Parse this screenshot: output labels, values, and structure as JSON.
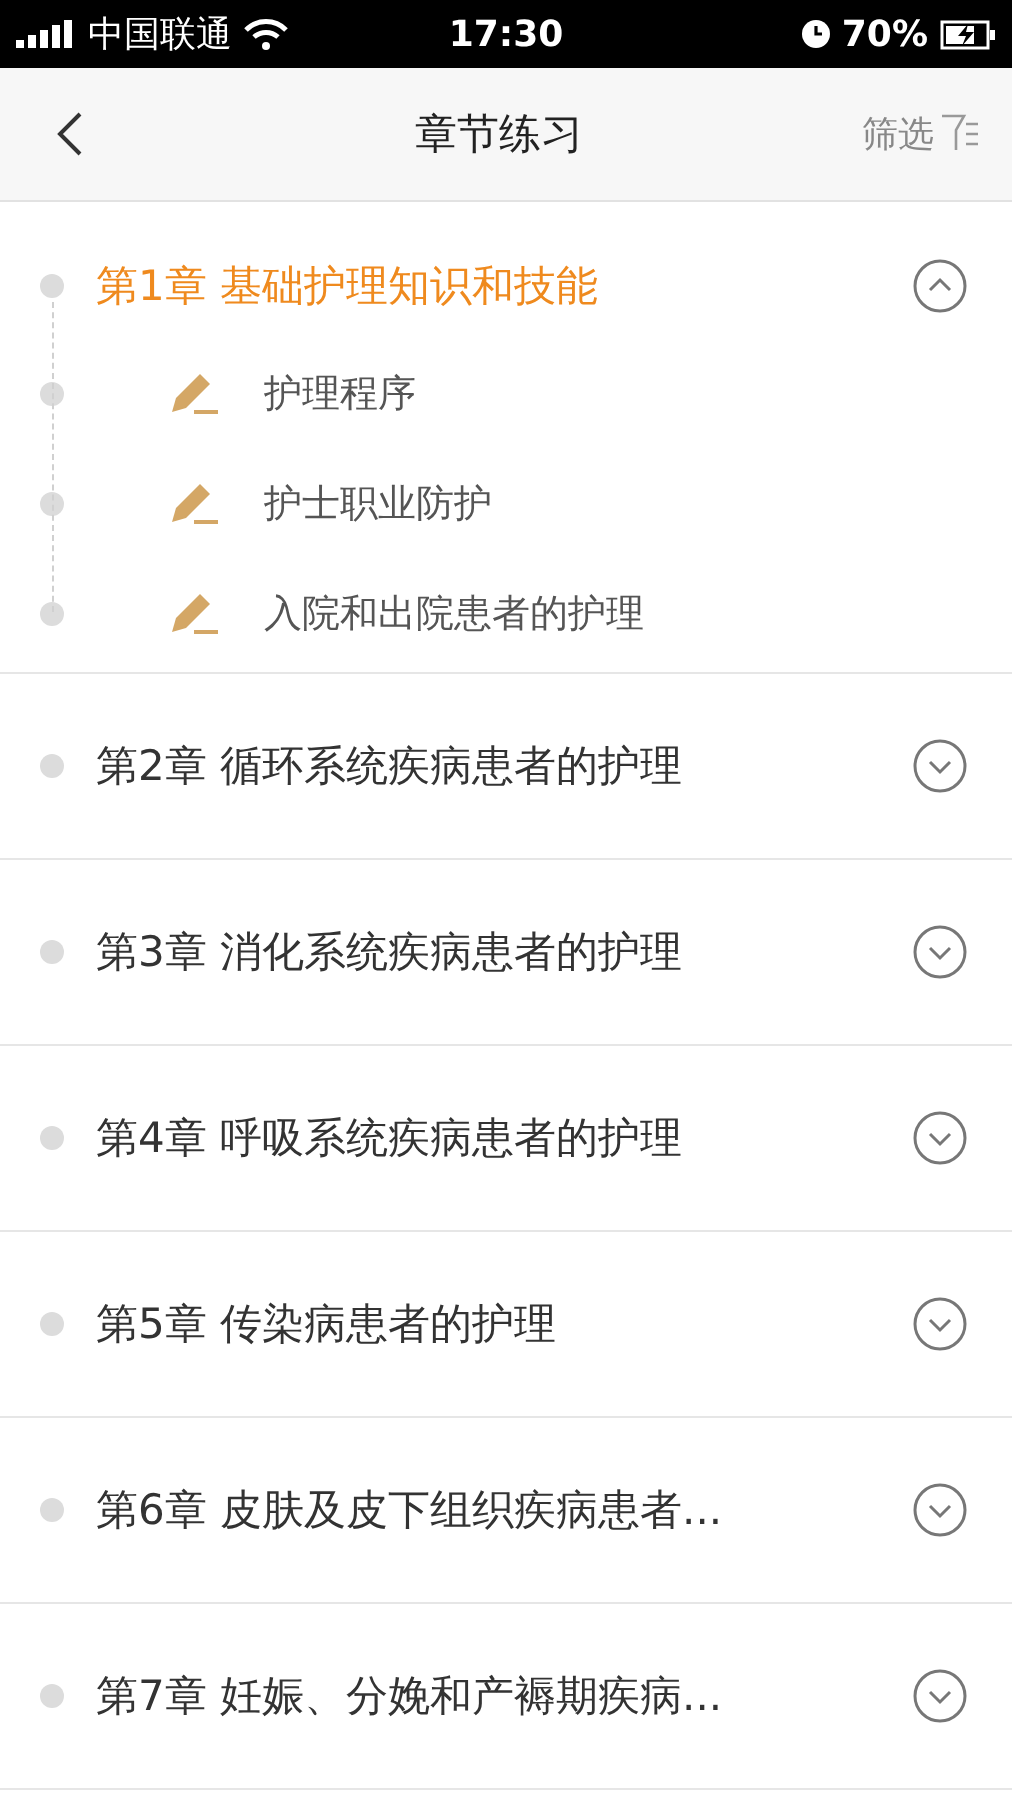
{
  "status_bar": {
    "carrier": "中国联通",
    "time": "17:30",
    "battery": "70%"
  },
  "nav": {
    "title": "章节练习",
    "filter": "筛选"
  },
  "chapters": [
    {
      "title": "第1章 基础护理知识和技能",
      "expanded": true,
      "sections": [
        "护理程序",
        "护士职业防护",
        "入院和出院患者的护理"
      ]
    },
    {
      "title": "第2章 循环系统疾病患者的护理",
      "expanded": false
    },
    {
      "title": "第3章 消化系统疾病患者的护理",
      "expanded": false
    },
    {
      "title": "第4章 呼吸系统疾病患者的护理",
      "expanded": false
    },
    {
      "title": "第5章 传染病患者的护理",
      "expanded": false
    },
    {
      "title": "第6章 皮肤及皮下组织疾病患者...",
      "expanded": false
    },
    {
      "title": "第7章 妊娠、分娩和产褥期疾病...",
      "expanded": false
    }
  ]
}
